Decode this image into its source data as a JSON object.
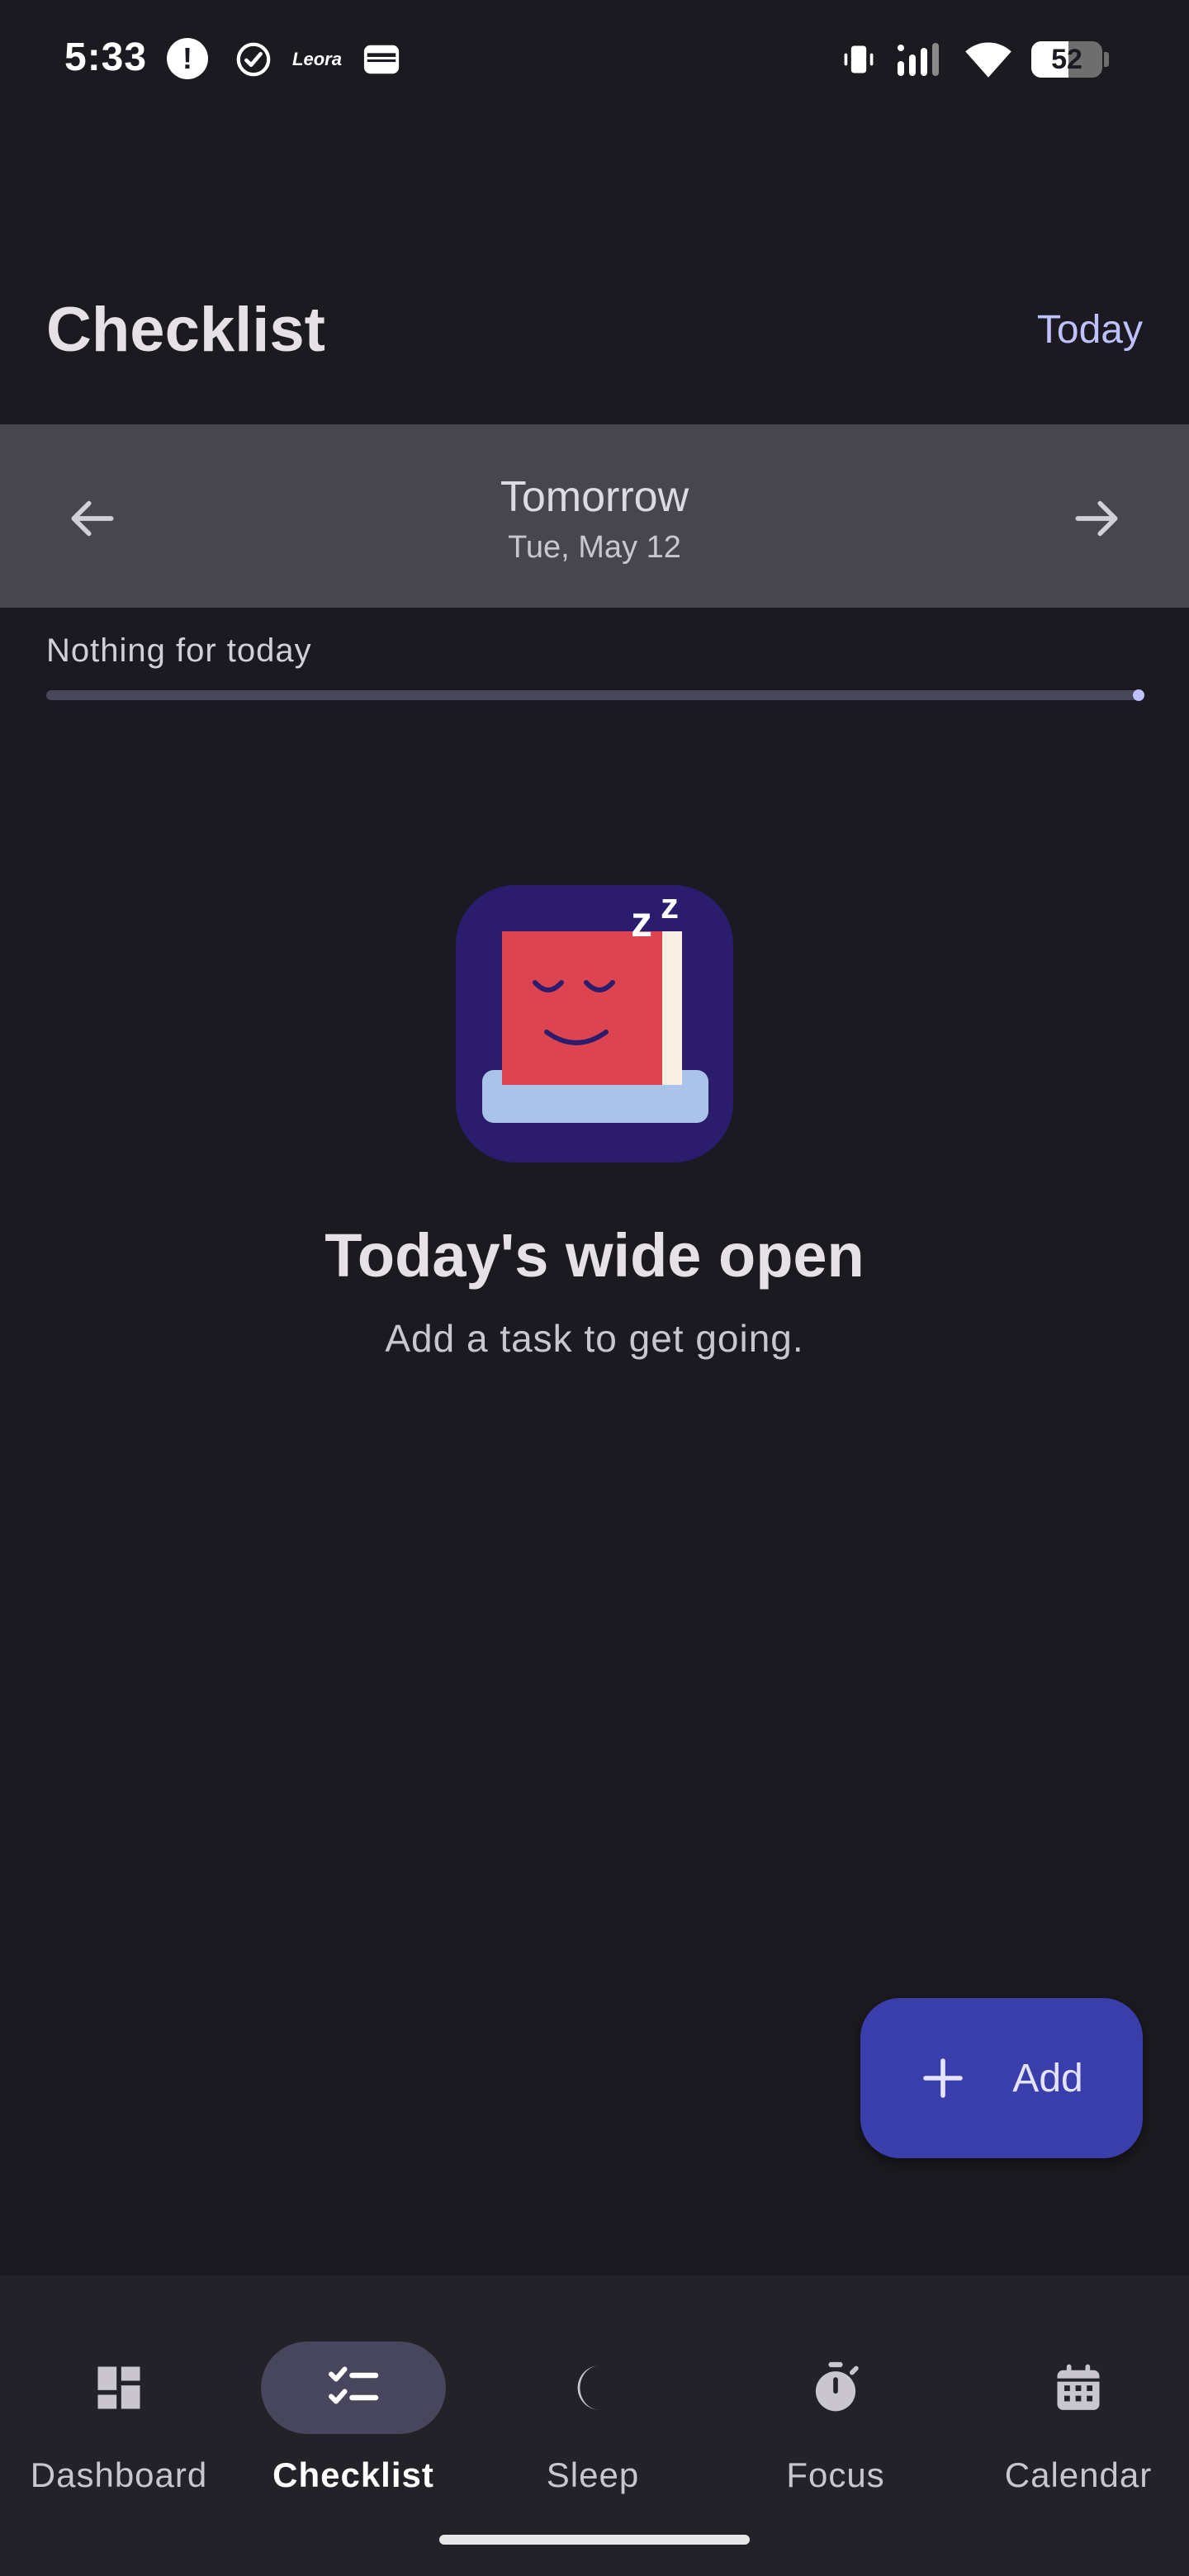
{
  "status_bar": {
    "time": "5:33",
    "alert_glyph": "!",
    "brand_text": "Leora",
    "battery_level": "52",
    "battery_fraction": 0.52
  },
  "header": {
    "title": "Checklist",
    "today_label": "Today"
  },
  "date_nav": {
    "title": "Tomorrow",
    "date": "Tue, May 12",
    "prev_icon": "arrow-left-icon",
    "next_icon": "arrow-right-icon"
  },
  "progress": {
    "label": "Nothing for today",
    "value": 0
  },
  "empty_state": {
    "title": "Today's wide open",
    "subtitle": "Add a task to get going.",
    "sleep_glyph": "z"
  },
  "fab": {
    "label": "Add",
    "icon": "plus-icon"
  },
  "bottom_nav": {
    "items": [
      {
        "label": "Dashboard",
        "icon": "dashboard-icon",
        "active": false
      },
      {
        "label": "Checklist",
        "icon": "checklist-icon",
        "active": true
      },
      {
        "label": "Sleep",
        "icon": "moon-icon",
        "active": false
      },
      {
        "label": "Focus",
        "icon": "stopwatch-icon",
        "active": false
      },
      {
        "label": "Calendar",
        "icon": "calendar-icon",
        "active": false
      }
    ]
  },
  "colors": {
    "background": "#1b1a20",
    "accent": "#bfc1ff",
    "fab": "#3a3eaa",
    "date_nav_bg": "#47464f",
    "nav_active_pill": "#47465c"
  }
}
